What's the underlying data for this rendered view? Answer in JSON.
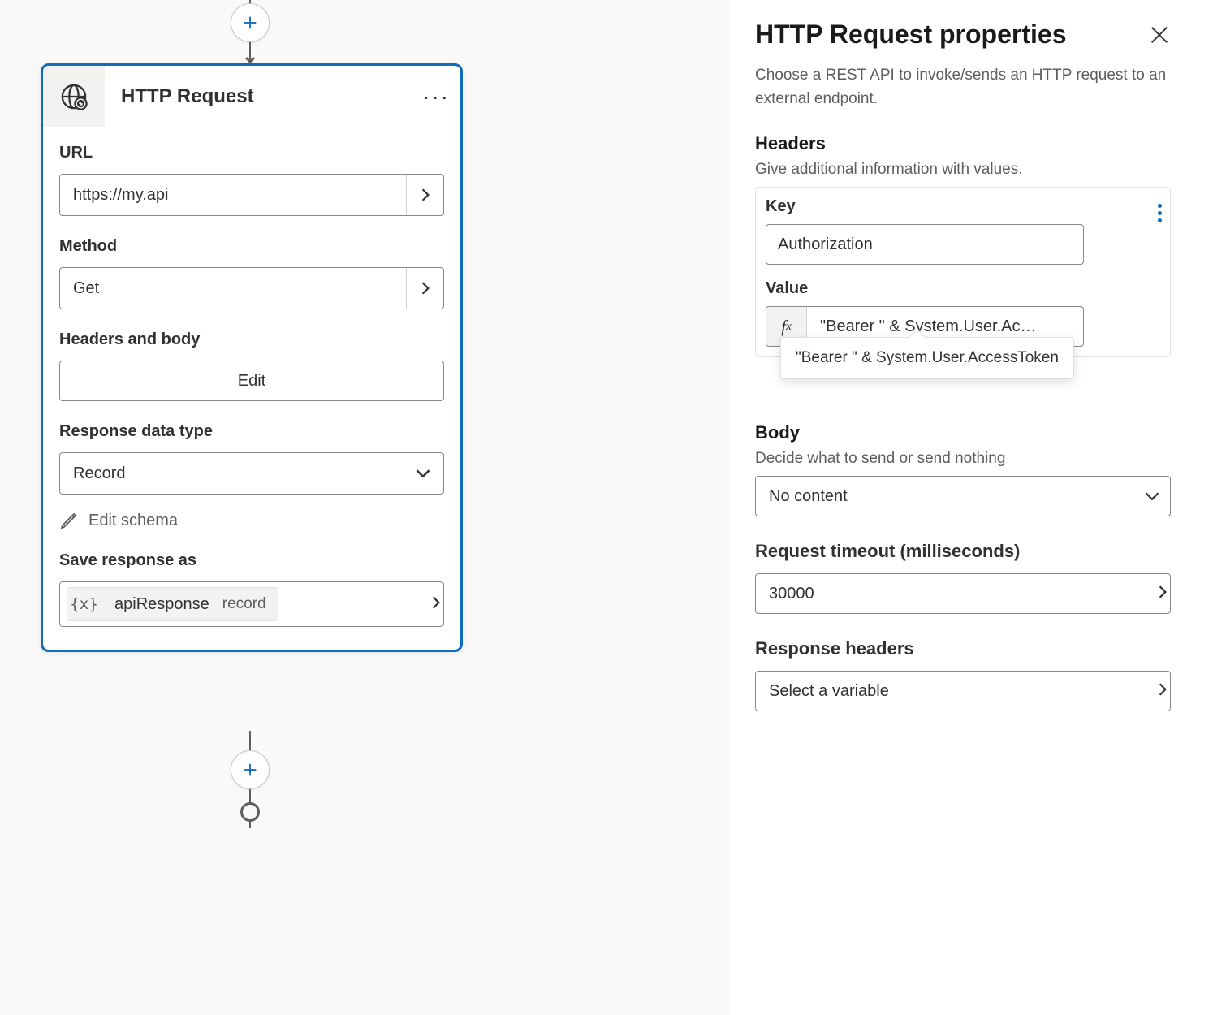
{
  "node": {
    "title": "HTTP Request",
    "url_label": "URL",
    "url_value": "https://my.api",
    "method_label": "Method",
    "method_value": "Get",
    "headers_body_label": "Headers and body",
    "edit_label": "Edit",
    "response_type_label": "Response data type",
    "response_type_value": "Record",
    "edit_schema_label": "Edit schema",
    "save_as_label": "Save response as",
    "save_var_name": "apiResponse",
    "save_var_type": "record"
  },
  "panel": {
    "title": "HTTP Request properties",
    "description": "Choose a REST API to invoke/sends an HTTP request to an external endpoint.",
    "headers_heading": "Headers",
    "headers_sub": "Give additional information with values.",
    "key_label": "Key",
    "key_value": "Authorization",
    "value_label": "Value",
    "value_truncated": "\"Bearer \" & System.User.Ac…",
    "value_full": "\"Bearer \" & System.User.AccessToken",
    "body_heading": "Body",
    "body_sub": "Decide what to send or send nothing",
    "body_value": "No content",
    "timeout_label": "Request timeout (milliseconds)",
    "timeout_value": "30000",
    "response_headers_label": "Response headers",
    "response_headers_value": "Select a variable"
  }
}
